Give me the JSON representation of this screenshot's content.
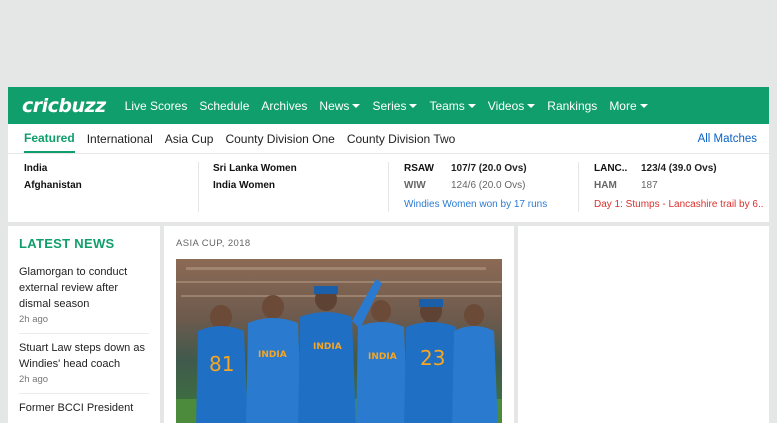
{
  "header": {
    "logo": "cricbuzz",
    "nav": [
      {
        "label": "Live Scores",
        "dropdown": false
      },
      {
        "label": "Schedule",
        "dropdown": false
      },
      {
        "label": "Archives",
        "dropdown": false
      },
      {
        "label": "News",
        "dropdown": true
      },
      {
        "label": "Series",
        "dropdown": true
      },
      {
        "label": "Teams",
        "dropdown": true
      },
      {
        "label": "Videos",
        "dropdown": true
      },
      {
        "label": "Rankings",
        "dropdown": false
      },
      {
        "label": "More",
        "dropdown": true
      }
    ]
  },
  "tabs": {
    "items": [
      "Featured",
      "International",
      "Asia Cup",
      "County Division One",
      "County Division Two"
    ],
    "active": "Featured",
    "all_matches": "All Matches"
  },
  "matches": [
    {
      "team1": "India",
      "score1": "",
      "team2": "Afghanistan",
      "score2": "",
      "status": ""
    },
    {
      "team1": "Sri Lanka Women",
      "score1": "",
      "team2": "India Women",
      "score2": "",
      "status": ""
    },
    {
      "team1": "RSAW",
      "score1": "107/7 (20.0 Ovs)",
      "team2": "WIW",
      "score2": "124/6 (20.0 Ovs)",
      "status": "Windies Women won by 17 runs",
      "status_color": "#2b7bd1"
    },
    {
      "team1": "LANC..",
      "score1": "123/4 (39.0 Ovs)",
      "team2": "HAM",
      "score2": "187",
      "status": "Day 1: Stumps - Lancashire trail by 6..",
      "status_color": "#d9312e"
    }
  ],
  "news": {
    "title": "LATEST NEWS",
    "items": [
      {
        "headline": "Glamorgan to conduct external review after dismal season",
        "time": "2h ago"
      },
      {
        "headline": "Stuart Law steps down as Windies' head coach",
        "time": "2h ago"
      },
      {
        "headline": "Former BCCI President",
        "time": ""
      }
    ]
  },
  "feature": {
    "category": "ASIA CUP, 2018",
    "jerseys": [
      "81",
      "INDIA",
      "INDIA",
      "INDIA",
      "23"
    ]
  },
  "colors": {
    "brand": "#109e6c",
    "link": "#0a62c6"
  }
}
